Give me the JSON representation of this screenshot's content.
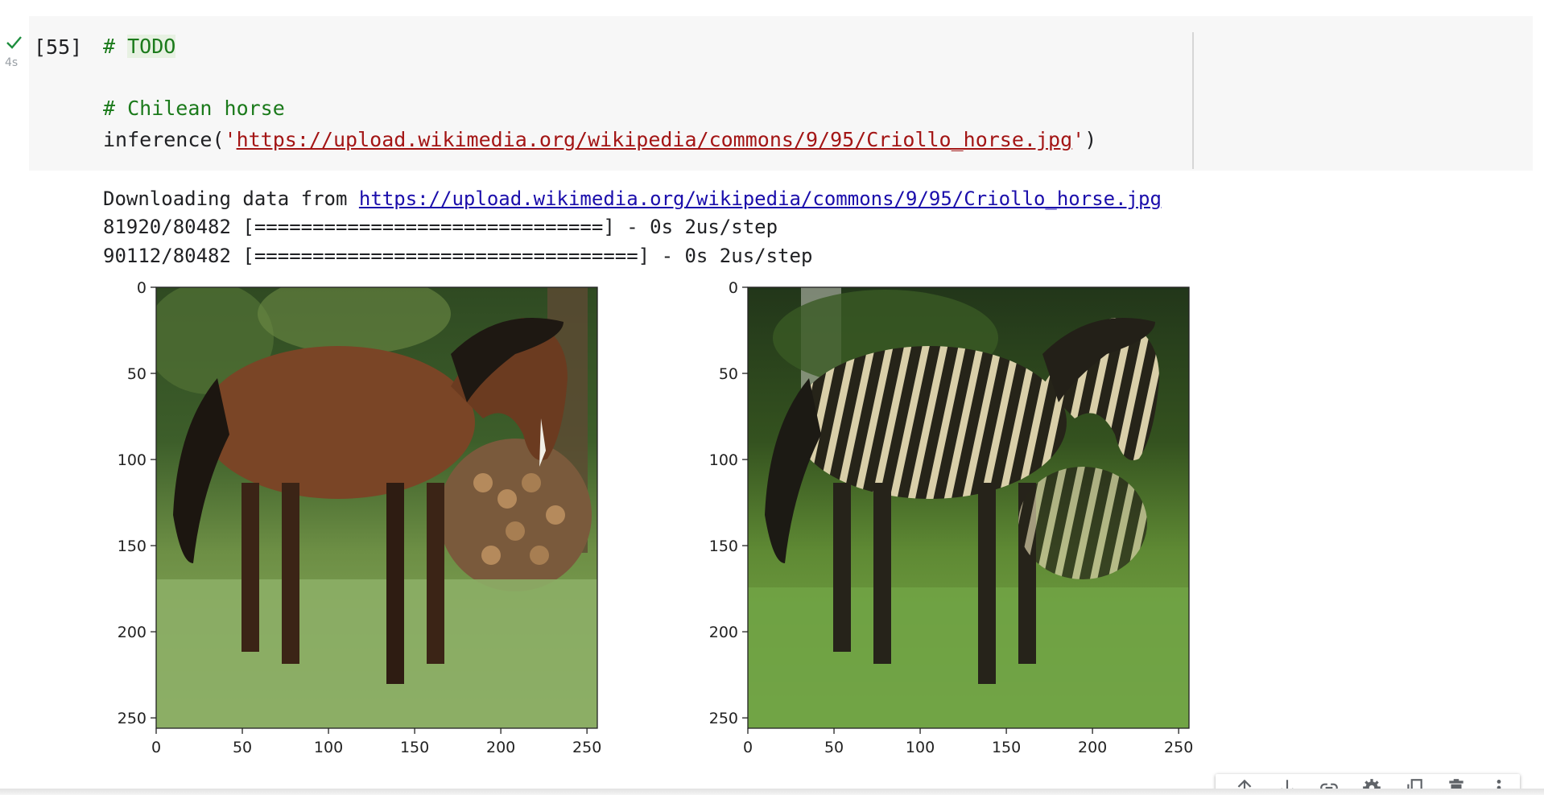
{
  "cell": {
    "execution_count": "[55]",
    "run_time": "4s",
    "status": "completed",
    "code": {
      "line1_comment": "# TODO",
      "line1_hash": "# ",
      "line1_todo": "TODO",
      "line2_comment": "# Chilean horse",
      "line3_func": "inference(",
      "line3_quote_open": "'",
      "line3_url": "https://upload.wikimedia.org/wikipedia/commons/9/95/Criollo_horse.jpg",
      "line3_quote_close": "'",
      "line3_paren": ")"
    }
  },
  "output": {
    "download_prefix": "Downloading data from ",
    "download_url": "https://upload.wikimedia.org/wikipedia/commons/9/95/Criollo_horse.jpg",
    "progress_lines": [
      "81920/80482 [==============================] - 0s 2us/step",
      "90112/80482 [=================================] - 0s 2us/step"
    ]
  },
  "figures": [
    {
      "name": "input-horse-image",
      "image_subject": "brown horse standing on grass in front of a wood pile",
      "y_ticks": [
        "0",
        "50",
        "100",
        "150",
        "200",
        "250"
      ],
      "x_ticks": [
        "0",
        "50",
        "100",
        "150",
        "200",
        "250"
      ],
      "colors": {
        "sky": "#5a7a3c",
        "horse": "#7a4526",
        "grass": "#7fa05a"
      }
    },
    {
      "name": "output-zebra-image",
      "image_subject": "horse translated to zebra stripes on grass",
      "y_ticks": [
        "0",
        "50",
        "100",
        "150",
        "200",
        "250"
      ],
      "x_ticks": [
        "0",
        "50",
        "100",
        "150",
        "200",
        "250"
      ],
      "colors": {
        "sky": "#3e5a2a",
        "horse": "#2b2a22",
        "stripe": "#d8cfae",
        "grass": "#6f9a48"
      }
    }
  ],
  "toolbar": {
    "buttons": [
      "move-up-icon",
      "move-down-icon",
      "link-icon",
      "settings-icon",
      "mirror-cell-icon",
      "delete-icon",
      "more-options-icon"
    ]
  }
}
